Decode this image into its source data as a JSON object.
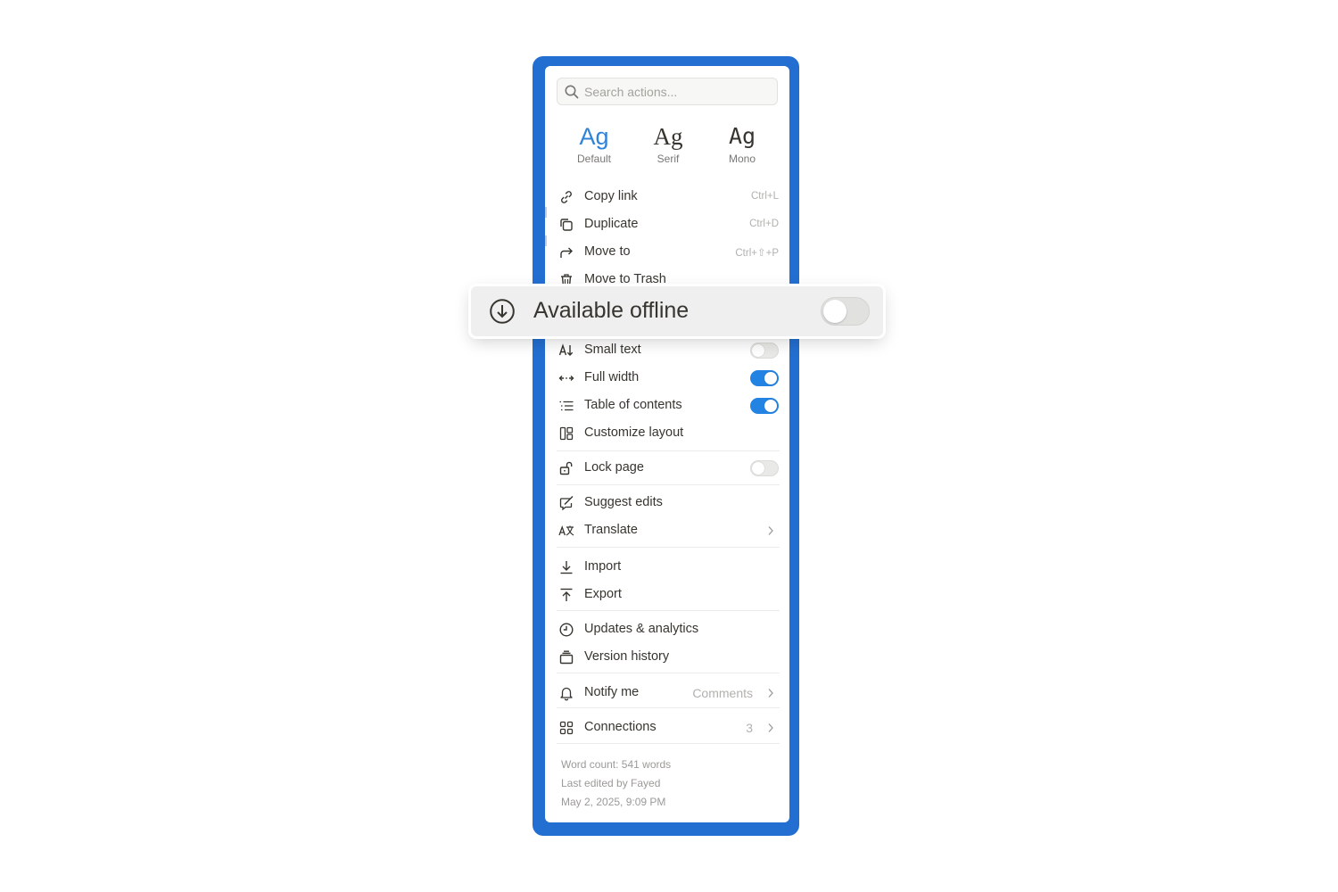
{
  "colors": {
    "highlight_frame": "#236fd1",
    "accent": "#2383e2",
    "toggle_off": "#e9e9e7",
    "muted_text": "#9b9a97"
  },
  "search": {
    "placeholder": "Search actions...",
    "icon": "search-icon"
  },
  "font_styles": [
    {
      "glyph": "Ag",
      "label": "Default",
      "selected": true
    },
    {
      "glyph": "Ag",
      "label": "Serif",
      "selected": false
    },
    {
      "glyph": "Ag",
      "label": "Mono",
      "selected": false
    }
  ],
  "actions": {
    "copy_link": {
      "label": "Copy link",
      "shortcut": "Ctrl+L",
      "icon": "link-icon"
    },
    "duplicate": {
      "label": "Duplicate",
      "shortcut": "Ctrl+D",
      "icon": "duplicate-icon"
    },
    "move_to": {
      "label": "Move to",
      "shortcut": "Ctrl+⇧+P",
      "icon": "move-arrow-icon"
    },
    "move_to_trash": {
      "label": "Move to Trash",
      "icon": "trash-icon"
    }
  },
  "available_offline": {
    "label": "Available offline",
    "icon": "download-circle-icon",
    "enabled": false
  },
  "display": {
    "small_text": {
      "label": "Small text",
      "icon": "small-text-icon",
      "enabled": false
    },
    "full_width": {
      "label": "Full width",
      "icon": "full-width-icon",
      "enabled": true
    },
    "table_of_contents": {
      "label": "Table of contents",
      "icon": "table-of-contents-icon",
      "enabled": true
    },
    "customize_layout": {
      "label": "Customize layout",
      "icon": "layout-icon"
    }
  },
  "lock_page": {
    "label": "Lock page",
    "icon": "unlock-icon",
    "enabled": false
  },
  "editing": {
    "suggest_edits": {
      "label": "Suggest edits",
      "icon": "suggest-edit-icon"
    },
    "translate": {
      "label": "Translate",
      "icon": "translate-icon"
    }
  },
  "transfer": {
    "import": {
      "label": "Import",
      "icon": "import-icon"
    },
    "export": {
      "label": "Export",
      "icon": "export-icon"
    }
  },
  "history": {
    "updates_analytics": {
      "label": "Updates & analytics",
      "icon": "clock-icon"
    },
    "version_history": {
      "label": "Version history",
      "icon": "version-history-icon"
    }
  },
  "notify_me": {
    "label": "Notify me",
    "value": "Comments",
    "icon": "bell-icon"
  },
  "connections": {
    "label": "Connections",
    "count": "3",
    "icon": "connections-grid-icon"
  },
  "footer": {
    "word_count": "Word count: 541 words",
    "last_edited_by": "Last edited by Fayed",
    "last_edited_at": "May 2, 2025, 9:09 PM"
  }
}
